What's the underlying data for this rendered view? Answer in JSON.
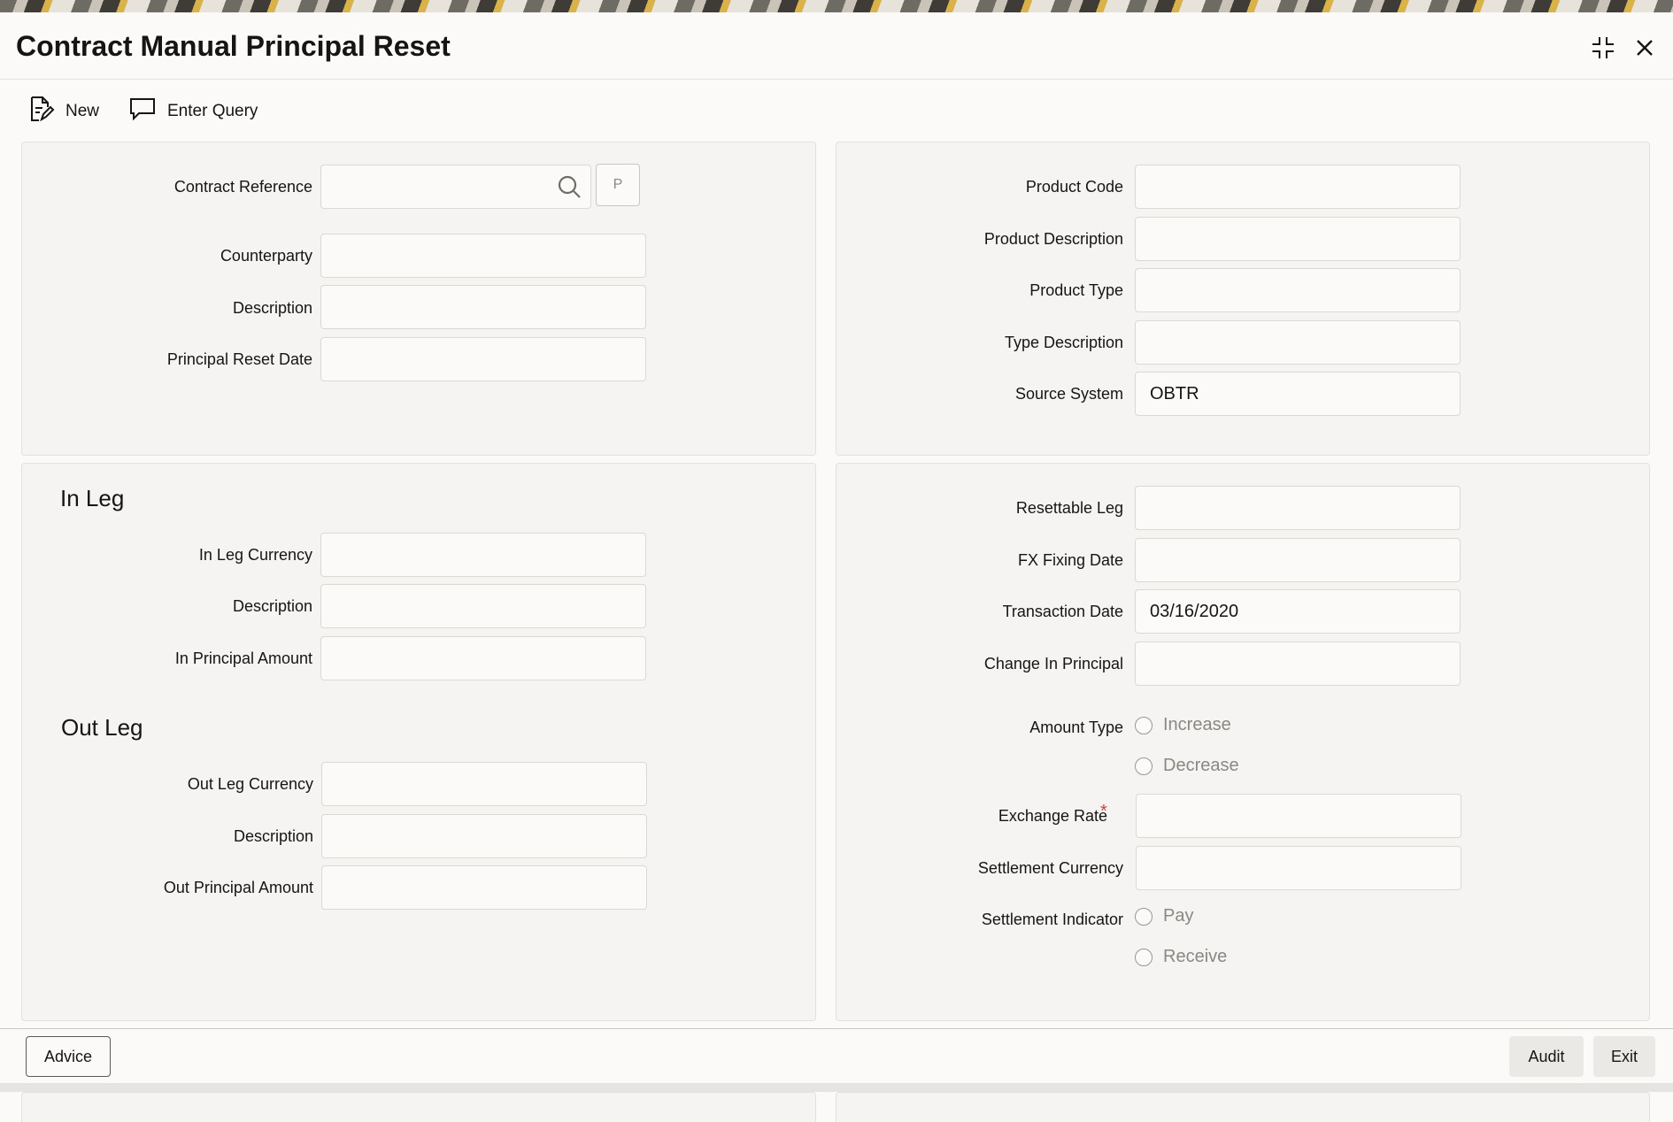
{
  "window": {
    "title": "Contract Manual Principal Reset"
  },
  "toolbar": {
    "new_label": "New",
    "enter_query_label": "Enter Query"
  },
  "header_left": {
    "contract_reference_label": "Contract Reference",
    "p_button_label": "P",
    "counterparty_label": "Counterparty",
    "description_label": "Description",
    "principal_reset_date_label": "Principal Reset Date"
  },
  "header_right": {
    "product_code_label": "Product Code",
    "product_description_label": "Product Description",
    "product_type_label": "Product Type",
    "type_description_label": "Type Description",
    "source_system_label": "Source System",
    "source_system_value": "OBTR"
  },
  "in_leg": {
    "title": "In Leg",
    "currency_label": "In Leg Currency",
    "description_label": "Description",
    "principal_amount_label": "In Principal Amount"
  },
  "out_leg": {
    "title": "Out Leg",
    "currency_label": "Out Leg Currency",
    "description_label": "Description",
    "principal_amount_label": "Out Principal Amount"
  },
  "details_right": {
    "resettable_leg_label": "Resettable Leg",
    "fx_fixing_date_label": "FX Fixing Date",
    "transaction_date_label": "Transaction Date",
    "transaction_date_value": "03/16/2020",
    "change_in_principal_label": "Change In Principal",
    "amount_type_label": "Amount Type",
    "amount_type_options": [
      "Increase",
      "Decrease"
    ],
    "exchange_rate_label": "Exchange Rate",
    "required_marker": "*",
    "settlement_currency_label": "Settlement Currency",
    "settlement_indicator_label": "Settlement Indicator",
    "settlement_indicator_options": [
      "Pay",
      "Receive"
    ]
  },
  "footer": {
    "advice_label": "Advice",
    "audit_label": "Audit",
    "exit_label": "Exit"
  },
  "icons": {
    "search": "search-icon",
    "new": "new-document-icon",
    "enter_query": "speech-bubble-icon",
    "minimize": "collapse-icon",
    "close": "close-icon"
  },
  "colors": {
    "required": "#c74634",
    "panel_bg": "#f5f4f2",
    "page_bg": "#fbfaf9"
  }
}
